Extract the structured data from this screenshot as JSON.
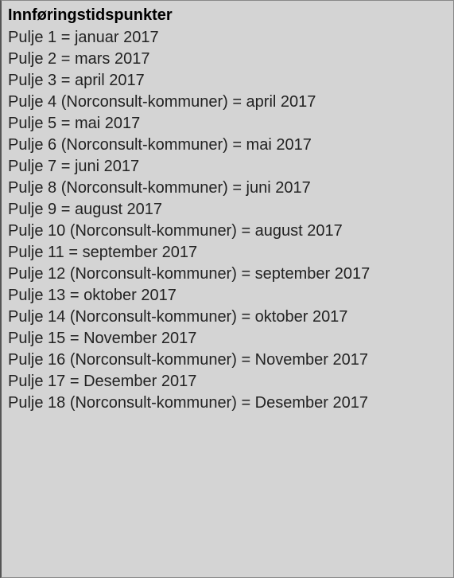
{
  "heading": "Innføringstidspunkter",
  "rows": [
    "Pulje 1 = januar 2017",
    "Pulje 2 = mars 2017",
    "Pulje 3 = april 2017",
    "Pulje 4 (Norconsult-kommuner) = april 2017",
    "Pulje 5 = mai 2017",
    "Pulje 6 (Norconsult-kommuner) = mai 2017",
    "Pulje 7 = juni 2017",
    "Pulje 8 (Norconsult-kommuner) = juni 2017",
    "Pulje 9 = august 2017",
    "Pulje 10 (Norconsult-kommuner) = august 2017",
    "Pulje 11 = september 2017",
    "Pulje 12 (Norconsult-kommuner) = september 2017",
    "Pulje 13 = oktober 2017",
    "Pulje 14 (Norconsult-kommuner) = oktober 2017",
    "Pulje 15 = November 2017",
    "Pulje 16 (Norconsult-kommuner) = November 2017",
    "Pulje 17 = Desember 2017",
    "Pulje 18 (Norconsult-kommuner) = Desember 2017"
  ]
}
